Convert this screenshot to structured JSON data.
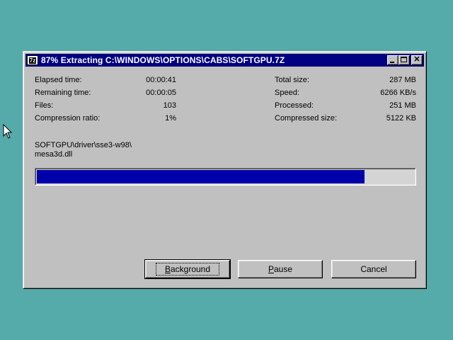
{
  "window": {
    "title": "87% Extracting C:\\WINDOWS\\OPTIONS\\CABS\\SOFTGPU.7Z",
    "icon_text": "7z",
    "controls": [
      "minimize-icon",
      "maximize-icon",
      "close-icon"
    ]
  },
  "stats_left": [
    {
      "label": "Elapsed time:",
      "value": "00:00:41"
    },
    {
      "label": "Remaining time:",
      "value": "00:00:05"
    },
    {
      "label": "Files:",
      "value": "103"
    },
    {
      "label": "Compression ratio:",
      "value": "1%"
    }
  ],
  "stats_right": [
    {
      "label": "Total size:",
      "value": "287 MB"
    },
    {
      "label": "Speed:",
      "value": "6266 KB/s"
    },
    {
      "label": "Processed:",
      "value": "251 MB"
    },
    {
      "label": "Compressed size:",
      "value": "5122 KB"
    }
  ],
  "current_file": {
    "line1": "SOFTGPU\\driver\\sse3-w98\\",
    "line2": "mesa3d.dll"
  },
  "progress": {
    "fraction": 0.87
  },
  "buttons": {
    "background": {
      "first": "B",
      "rest": "ackground"
    },
    "pause": {
      "first": "P",
      "rest": "ause"
    },
    "cancel": "Cancel"
  },
  "colors": {
    "desktop": "#55aaaa",
    "titlebar": "#000080",
    "progress": "#0000aa"
  }
}
